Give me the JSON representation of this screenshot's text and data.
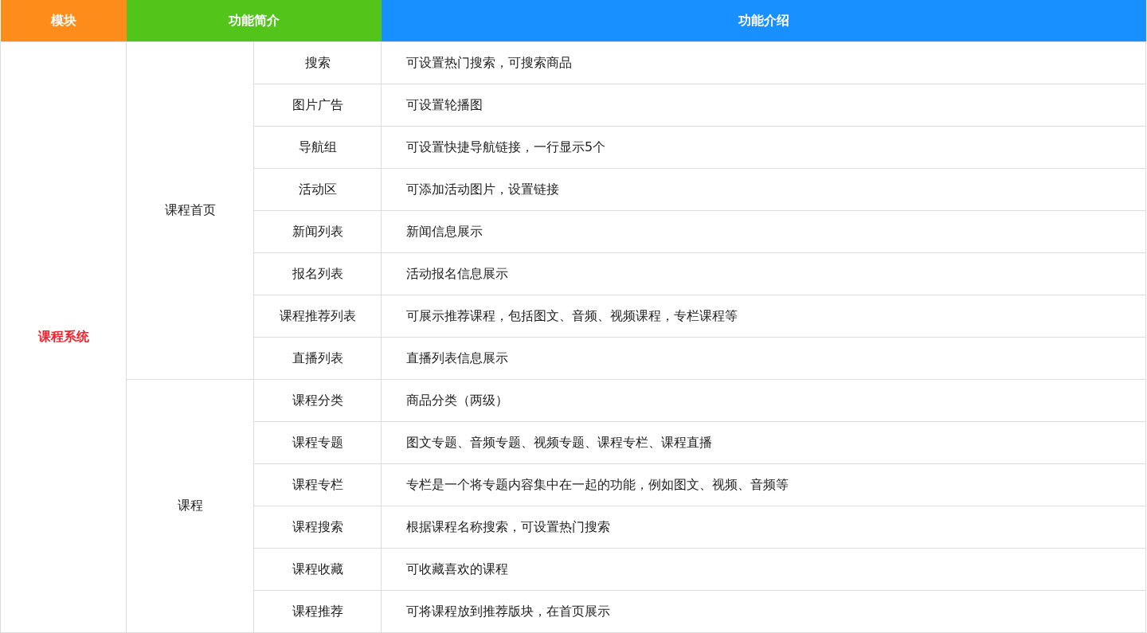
{
  "table": {
    "columns": [
      {
        "label": "模块",
        "color": "#fd8c1a"
      },
      {
        "label": "功能简介",
        "color": "#52c41a"
      },
      {
        "label": "功能介绍",
        "color": "#1890ff"
      }
    ],
    "module": "课程系统",
    "groups": [
      {
        "name": "课程首页",
        "features": [
          {
            "name": "搜索",
            "description": "可设置热门搜索，可搜索商品"
          },
          {
            "name": "图片广告",
            "description": "可设置轮播图"
          },
          {
            "name": "导航组",
            "description": "可设置快捷导航链接，一行显示5个"
          },
          {
            "name": "活动区",
            "description": "可添加活动图片，设置链接"
          },
          {
            "name": "新闻列表",
            "description": "新闻信息展示"
          },
          {
            "name": "报名列表",
            "description": "活动报名信息展示"
          },
          {
            "name": "课程推荐列表",
            "description": "可展示推荐课程，包括图文、音频、视频课程，专栏课程等"
          },
          {
            "name": "直播列表",
            "description": "直播列表信息展示"
          }
        ]
      },
      {
        "name": "课程",
        "features": [
          {
            "name": "课程分类",
            "description": "商品分类（两级）"
          },
          {
            "name": "课程专题",
            "description": "图文专题、音频专题、视频专题、课程专栏、课程直播"
          },
          {
            "name": "课程专栏",
            "description": "专栏是一个将专题内容集中在一起的功能，例如图文、视频、音频等"
          },
          {
            "name": "课程搜索",
            "description": "根据课程名称搜索，可设置热门搜索"
          },
          {
            "name": "课程收藏",
            "description": "可收藏喜欢的课程"
          },
          {
            "name": "课程推荐",
            "description": "可将课程放到推荐版块，在首页展示"
          }
        ]
      }
    ]
  }
}
